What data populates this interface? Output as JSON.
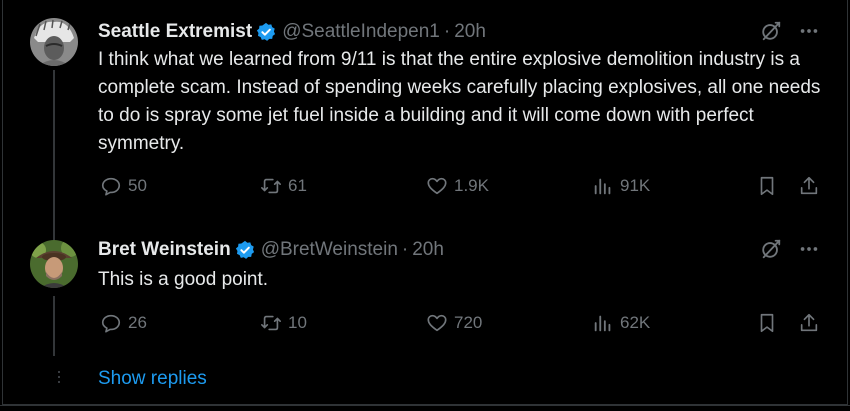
{
  "tweets": [
    {
      "author_name": "Seattle Extremist",
      "handle": "@SeattleIndepen1",
      "time": "20h",
      "verified": true,
      "text": "I think what we learned from 9/11 is that the entire explosive demolition industry is a complete scam.  Instead of spending weeks carefully placing explosives, all one needs to do is spray some jet fuel inside a building and it will come down with perfect symmetry.",
      "replies": "50",
      "retweets": "61",
      "likes": "1.9K",
      "views": "91K"
    },
    {
      "author_name": "Bret Weinstein",
      "handle": "@BretWeinstein",
      "time": "20h",
      "verified": true,
      "text": "This is a good point.",
      "replies": "26",
      "retweets": "10",
      "likes": "720",
      "views": "62K"
    }
  ],
  "separator": "·",
  "show_replies_label": "Show replies",
  "colors": {
    "accent": "#1d9bf0",
    "muted": "#71767b",
    "background": "#000000",
    "text": "#e7e9ea"
  },
  "icons": [
    "verified-badge-icon",
    "grok-icon",
    "more-icon",
    "reply-icon",
    "retweet-icon",
    "like-icon",
    "views-icon",
    "bookmark-icon",
    "share-icon"
  ]
}
